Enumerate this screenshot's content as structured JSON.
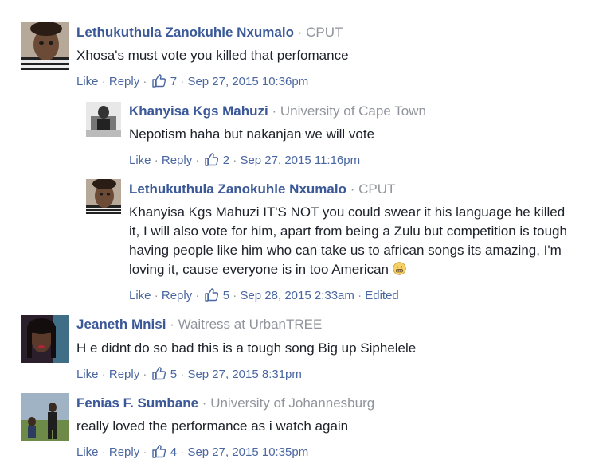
{
  "comments": [
    {
      "author": "Lethukuthula Zanokuhle Nxumalo",
      "affiliation": "CPUT",
      "text": "Xhosa's must vote you killed that perfomance",
      "like_label": "Like",
      "reply_label": "Reply",
      "likes": "7",
      "time": "Sep 27, 2015 10:36pm"
    },
    {
      "author": "Khanyisa Kgs Mahuzi",
      "affiliation": "University of Cape Town",
      "text": "Nepotism haha but nakanjan we will vote",
      "like_label": "Like",
      "reply_label": "Reply",
      "likes": "2",
      "time": "Sep 27, 2015 11:16pm"
    },
    {
      "author": "Lethukuthula Zanokuhle Nxumalo",
      "affiliation": "CPUT",
      "text": "Khanyisa Kgs Mahuzi IT'S NOT you could swear it his language he killed it, I will also vote for him, apart from being a Zulu but competition is tough having people like him who can take us to african songs its amazing, I'm loving it, cause everyone is in too American",
      "like_label": "Like",
      "reply_label": "Reply",
      "likes": "5",
      "time": "Sep 28, 2015 2:33am",
      "edited": "Edited"
    },
    {
      "author": "Jeaneth Mnisi",
      "affiliation": "Waitress at UrbanTREE",
      "text": "H e didnt do so bad this is a tough song Big up Siphelele",
      "like_label": "Like",
      "reply_label": "Reply",
      "likes": "5",
      "time": "Sep 27, 2015 8:31pm"
    },
    {
      "author": "Fenias F. Sumbane",
      "affiliation": "University of Johannesburg",
      "text": "really loved the performance as i watch again",
      "like_label": "Like",
      "reply_label": "Reply",
      "likes": "4",
      "time": "Sep 27, 2015 10:35pm"
    }
  ],
  "separator": "·",
  "icons": {
    "like": "thumbs-up-icon",
    "emoji": "grimace-emoji-icon"
  },
  "colors": {
    "author": "#3b5998",
    "link": "#4b67a1",
    "muted": "#90949c",
    "text": "#1d2129"
  }
}
